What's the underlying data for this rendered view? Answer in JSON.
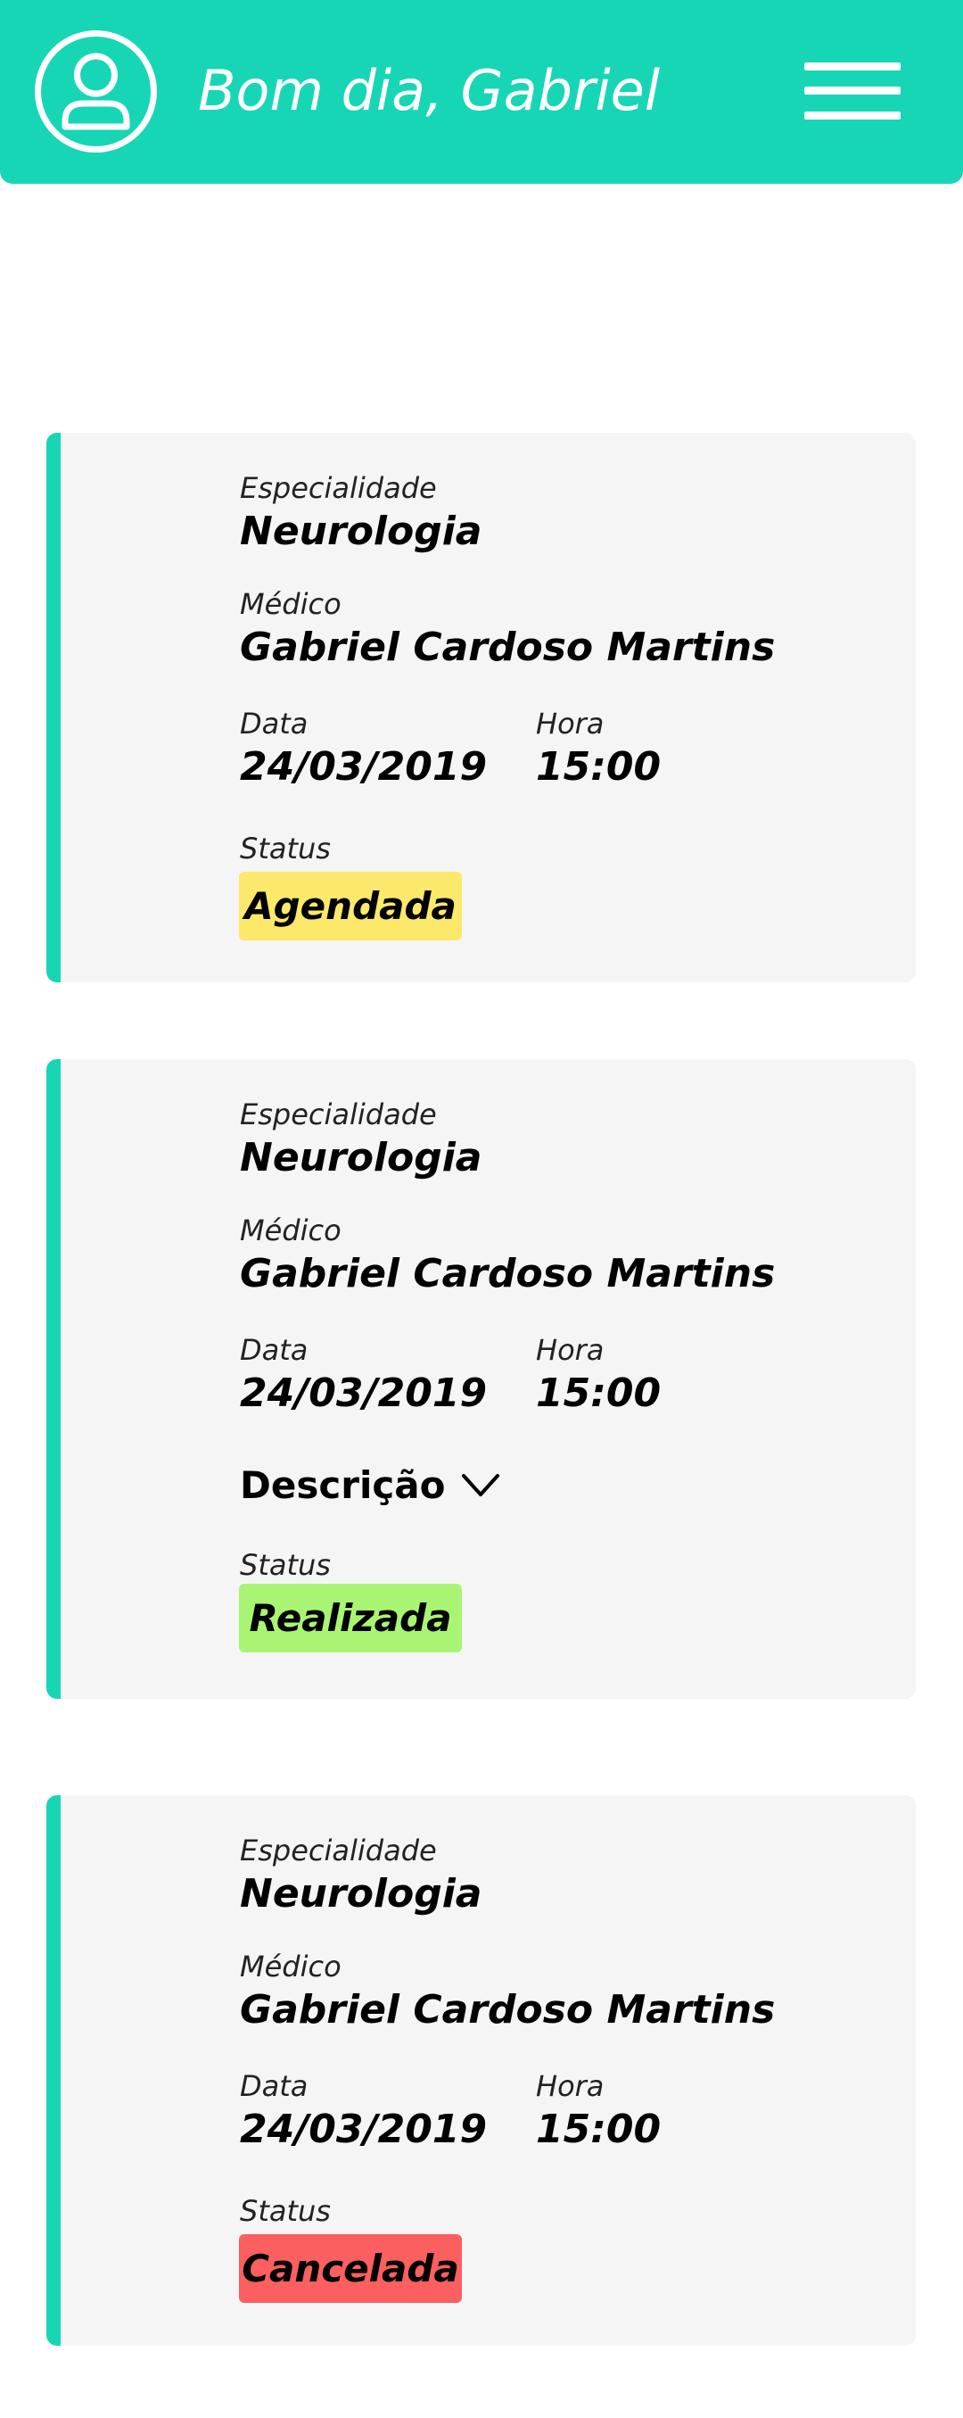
{
  "header": {
    "greeting": "Bom dia, Gabriel",
    "avatar_icon": "user-circle-icon",
    "menu_icon": "hamburger-menu-icon",
    "background_color": "#17d6b5"
  },
  "labels": {
    "specialty": "Especialidade",
    "doctor": "Médico",
    "date": "Data",
    "time": "Hora",
    "status": "Status",
    "description": "Descrição"
  },
  "appointments": [
    {
      "specialty": "Neurologia",
      "doctor": "Gabriel Cardoso Martins",
      "date": "24/03/2019",
      "time": "15:00",
      "status": "Agendada",
      "status_color": "#fce86a"
    },
    {
      "specialty": "Neurologia",
      "doctor": "Gabriel Cardoso Martins",
      "date": "24/03/2019",
      "time": "15:00",
      "status": "Realizada",
      "status_color": "#a9f573"
    },
    {
      "specialty": "Neurologia",
      "doctor": "Gabriel Cardoso Martins",
      "date": "24/03/2019",
      "time": "15:00",
      "status": "Cancelada",
      "status_color": "#fb5f5f"
    }
  ]
}
